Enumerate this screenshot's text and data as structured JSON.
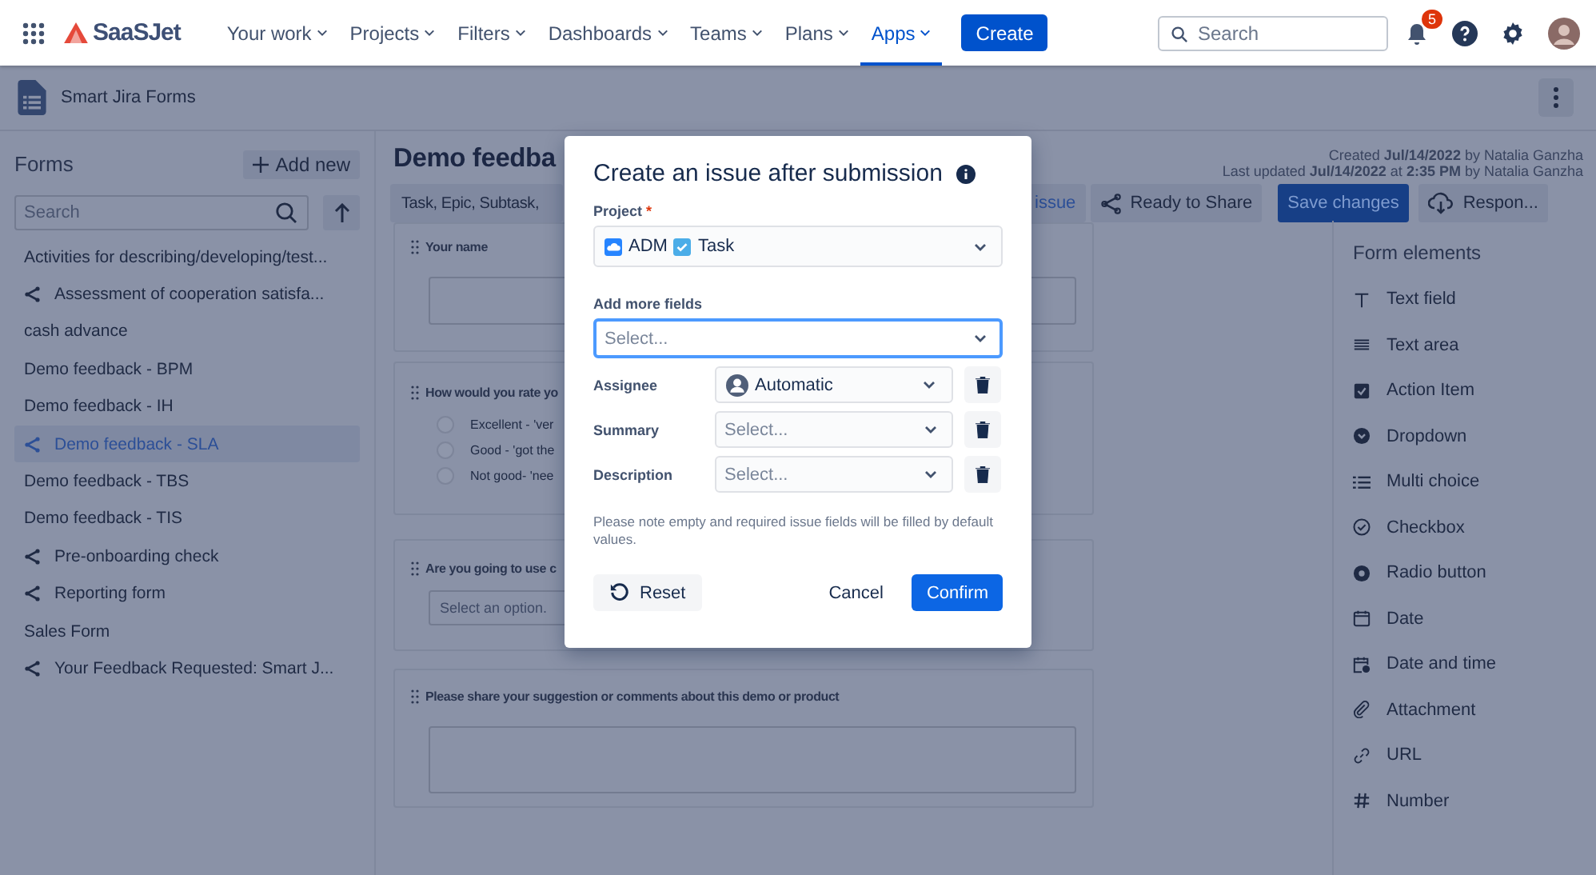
{
  "nav": {
    "logo": "SaaSJet",
    "create": "Create",
    "search": {
      "placeholder": "Search"
    },
    "notifications": "5",
    "menus": [
      {
        "label": "Your work",
        "selected": false
      },
      {
        "label": "Projects",
        "selected": false
      },
      {
        "label": "Filters",
        "selected": false
      },
      {
        "label": "Dashboards",
        "selected": false
      },
      {
        "label": "Teams",
        "selected": false
      },
      {
        "label": "Plans",
        "selected": false
      },
      {
        "label": "Apps",
        "selected": true
      }
    ]
  },
  "app_bar": {
    "title": "Smart Jira Forms"
  },
  "sidebar": {
    "title": "Forms",
    "add": "Add new",
    "search": {
      "placeholder": "Search"
    },
    "items": [
      {
        "label": "Activities for describing/developing/test...",
        "shared": false,
        "selected": false
      },
      {
        "label": "Assessment of cooperation satisfa...",
        "shared": true,
        "selected": false
      },
      {
        "label": "cash advance",
        "shared": false,
        "selected": false
      },
      {
        "label": "Demo feedback - BPM",
        "shared": false,
        "selected": false
      },
      {
        "label": "Demo feedback - IH",
        "shared": false,
        "selected": false
      },
      {
        "label": "Demo feedback - SLA",
        "shared": true,
        "selected": true
      },
      {
        "label": "Demo feedback - TBS",
        "shared": false,
        "selected": false
      },
      {
        "label": "Demo feedback - TIS",
        "shared": false,
        "selected": false
      },
      {
        "label": "Pre-onboarding check",
        "shared": true,
        "selected": false
      },
      {
        "label": "Reporting form",
        "shared": true,
        "selected": false
      },
      {
        "label": "Sales Form",
        "shared": false,
        "selected": false
      },
      {
        "label": "Your Feedback Requested: Smart J...",
        "shared": true,
        "selected": false
      }
    ]
  },
  "form": {
    "title": "Demo feedba",
    "meta": [
      "Created **Jul/14/2022** by Natalia Ganzha",
      "Last updated **Jul/14/2022** at **2:35 PM** by Natalia Ganzha"
    ],
    "toolbar": {
      "issue_types": "Task, Epic, Subtask,",
      "issue": "issue",
      "share": "Ready to Share",
      "save": "Save changes",
      "responses": "Respon..."
    },
    "questions": [
      {
        "kind": "text",
        "label": "Your name"
      },
      {
        "kind": "radio",
        "label": "How would you rate yo",
        "options": [
          {
            "label": "Excellent - 'ver",
            "selected": false
          },
          {
            "label": "Good - 'got the",
            "selected": false
          },
          {
            "label": "Not good- 'nee",
            "selected": false
          }
        ]
      },
      {
        "kind": "select",
        "label": "Are you going to use c",
        "placeholder": "Select an option."
      },
      {
        "kind": "textarea",
        "label": "Please share your suggestion or comments about this demo or product"
      }
    ]
  },
  "elements": {
    "title": "Form elements",
    "items": [
      {
        "kind": "text",
        "label": "Text field"
      },
      {
        "kind": "textarea",
        "label": "Text area"
      },
      {
        "kind": "action",
        "label": "Action Item"
      },
      {
        "kind": "dropdown",
        "label": "Dropdown"
      },
      {
        "kind": "multi",
        "label": "Multi choice"
      },
      {
        "kind": "checkbox",
        "label": "Checkbox"
      },
      {
        "kind": "radio",
        "label": "Radio button"
      },
      {
        "kind": "date",
        "label": "Date"
      },
      {
        "kind": "datetime",
        "label": "Date and time"
      },
      {
        "kind": "attachment",
        "label": "Attachment"
      },
      {
        "kind": "url",
        "label": "URL"
      },
      {
        "kind": "number",
        "label": "Number"
      }
    ]
  },
  "dialog": {
    "title": "Create an issue after submission",
    "project": {
      "label": "Project",
      "required_mark": "*",
      "value": "ADM",
      "issue_type": "Task"
    },
    "more": {
      "label": "Add more fields",
      "placeholder": "Select..."
    },
    "fields": [
      {
        "label": "Assignee",
        "value": "Automatic"
      },
      {
        "label": "Summary",
        "placeholder": "Select..."
      },
      {
        "label": "Description",
        "placeholder": "Select..."
      }
    ],
    "note": "Please note empty and required issue fields will be filled by default values.",
    "reset": "Reset",
    "cancel": "Cancel",
    "confirm": "Confirm"
  }
}
